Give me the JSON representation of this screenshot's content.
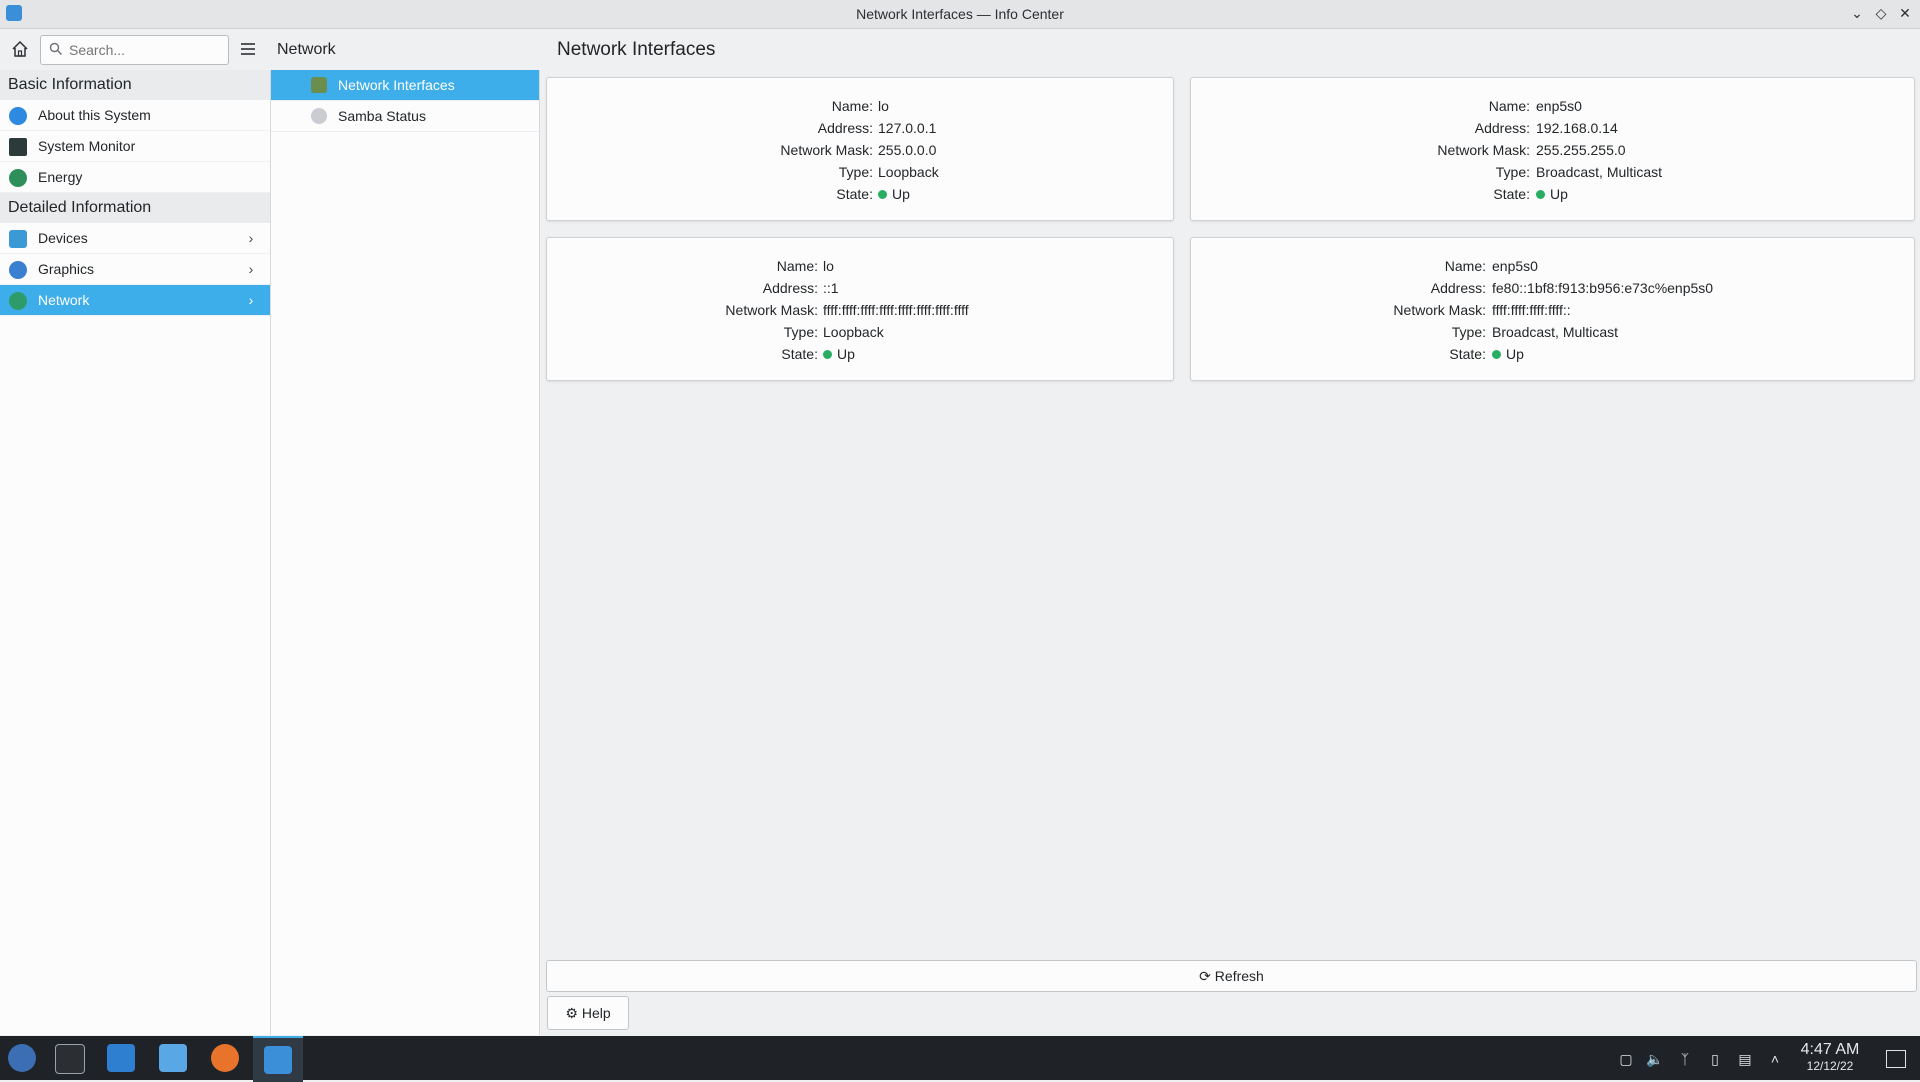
{
  "window": {
    "title": "Network Interfaces — Info Center"
  },
  "topbar": {
    "search_placeholder": "Search...",
    "section_title": "Network",
    "page_title": "Network Interfaces"
  },
  "sidebar": {
    "groups": [
      {
        "header": "Basic Information",
        "items": [
          "About this System",
          "System Monitor",
          "Energy"
        ]
      },
      {
        "header": "Detailed Information",
        "items": [
          "Devices",
          "Graphics",
          "Network"
        ]
      }
    ]
  },
  "subpanel": {
    "items": [
      "Network Interfaces",
      "Samba Status"
    ]
  },
  "labels": {
    "name": "Name:",
    "address": "Address:",
    "mask": "Network Mask:",
    "type": "Type:",
    "state": "State:"
  },
  "interfaces": [
    {
      "name": "lo",
      "address": "127.0.0.1",
      "mask": "255.0.0.0",
      "type": "Loopback",
      "state": "Up"
    },
    {
      "name": "enp5s0",
      "address": "192.168.0.14",
      "mask": "255.255.255.0",
      "type": "Broadcast, Multicast",
      "state": "Up"
    },
    {
      "name": "lo",
      "address": "::1",
      "mask": "ffff:ffff:ffff:ffff:ffff:ffff:ffff:ffff",
      "type": "Loopback",
      "state": "Up"
    },
    {
      "name": "enp5s0",
      "address": "fe80::1bf8:f913:b956:e73c%enp5s0",
      "mask": "ffff:ffff:ffff:ffff::",
      "type": "Broadcast, Multicast",
      "state": "Up"
    }
  ],
  "buttons": {
    "refresh": "Refresh",
    "help": "Help"
  },
  "clock": {
    "time": "4:47 AM",
    "date": "12/12/22"
  },
  "colors": {
    "accent": "#3daee9",
    "state_up": "#27ae60"
  }
}
